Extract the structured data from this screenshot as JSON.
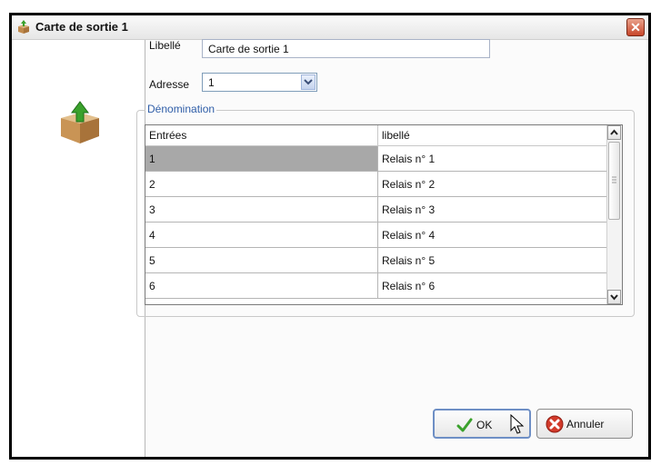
{
  "window": {
    "title": "Carte de sortie 1",
    "close_glyph": "✕",
    "icon": "box-arrow-icon"
  },
  "form": {
    "libelle_label": "Libellé",
    "libelle_value": "Carte de sortie 1",
    "adresse_label": "Adresse",
    "adresse_value": "1"
  },
  "group": {
    "title": "Dénomination",
    "columns": [
      "Entrées",
      "libellé"
    ],
    "rows": [
      {
        "entree": "1",
        "libelle": "Relais n° 1"
      },
      {
        "entree": "2",
        "libelle": "Relais n° 2"
      },
      {
        "entree": "3",
        "libelle": "Relais n° 3"
      },
      {
        "entree": "4",
        "libelle": "Relais n° 4"
      },
      {
        "entree": "5",
        "libelle": "Relais n° 5"
      },
      {
        "entree": "6",
        "libelle": "Relais n° 6"
      }
    ],
    "selected_row": 0
  },
  "buttons": {
    "ok_label": "OK",
    "cancel_label": "Annuler"
  },
  "colors": {
    "accent": "#2f5ea8",
    "ok_check": "#3aa12c",
    "cancel_red": "#d23a2a"
  }
}
